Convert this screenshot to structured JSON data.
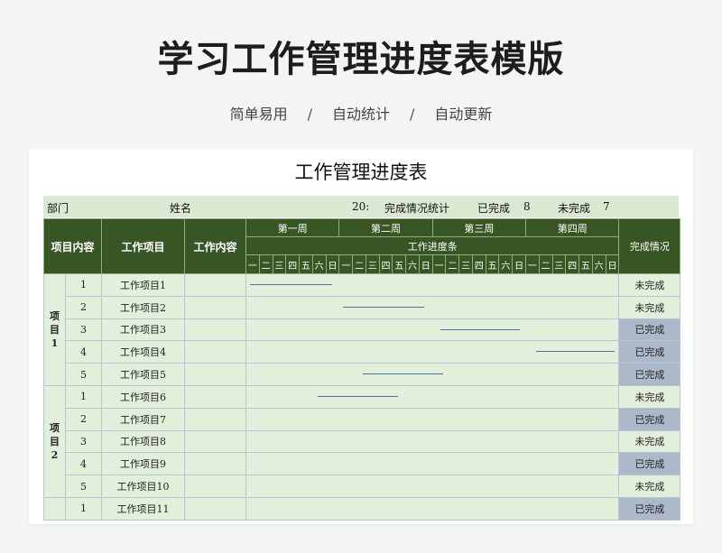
{
  "hero": {
    "title": "学习工作管理进度表模版",
    "tags": [
      "简单易用",
      "自动统计",
      "自动更新"
    ],
    "separator": "/"
  },
  "sheet": {
    "title": "工作管理进度表",
    "info": {
      "dept_label": "部门",
      "name_label": "姓名",
      "year": "20:",
      "stats_label": "完成情况统计",
      "done_label": "已完成",
      "done_count": "8",
      "undone_label": "未完成",
      "undone_count": "7"
    },
    "headers": {
      "project_content": "项目内容",
      "work_item": "工作项目",
      "work_content": "工作内容",
      "weeks": [
        "第一周",
        "第二周",
        "第三周",
        "第四周"
      ],
      "progress": "工作进度条",
      "days": [
        "一",
        "二",
        "三",
        "四",
        "五",
        "六",
        "日"
      ],
      "status": "完成情况"
    },
    "groups": [
      {
        "label": "项目1",
        "rows": 5
      },
      {
        "label": "项目2",
        "rows": 5
      },
      {
        "label": "",
        "rows": 1
      }
    ],
    "rows": [
      {
        "no": "1",
        "item": "工作项目1",
        "status": "未完成",
        "done": false,
        "bar_start_day": 1,
        "bar_end_day": 7.2
      },
      {
        "no": "2",
        "item": "工作项目2",
        "status": "未完成",
        "done": false,
        "bar_start_day": 8,
        "bar_end_day": 14.1
      },
      {
        "no": "3",
        "item": "工作项目3",
        "status": "已完成",
        "done": true,
        "bar_start_day": 15.3,
        "bar_end_day": 21.3
      },
      {
        "no": "4",
        "item": "工作项目4",
        "status": "已完成",
        "done": true,
        "bar_start_day": 22.5,
        "bar_end_day": 28.4
      },
      {
        "no": "5",
        "item": "工作项目5",
        "status": "已完成",
        "done": true,
        "bar_start_day": 9.5,
        "bar_end_day": 15.5
      },
      {
        "no": "1",
        "item": "工作项目6",
        "status": "未完成",
        "done": false,
        "bar_start_day": 6.1,
        "bar_end_day": 12.1
      },
      {
        "no": "2",
        "item": "工作项目7",
        "status": "已完成",
        "done": true,
        "bar_start_day": null,
        "bar_end_day": null
      },
      {
        "no": "3",
        "item": "工作项目8",
        "status": "未完成",
        "done": false,
        "bar_start_day": null,
        "bar_end_day": null
      },
      {
        "no": "4",
        "item": "工作项目9",
        "status": "已完成",
        "done": true,
        "bar_start_day": null,
        "bar_end_day": null
      },
      {
        "no": "5",
        "item": "工作项目10",
        "status": "未完成",
        "done": false,
        "bar_start_day": null,
        "bar_end_day": null
      },
      {
        "no": "1",
        "item": "工作项目11",
        "status": "已完成",
        "done": true,
        "bar_start_day": null,
        "bar_end_day": null
      }
    ]
  }
}
